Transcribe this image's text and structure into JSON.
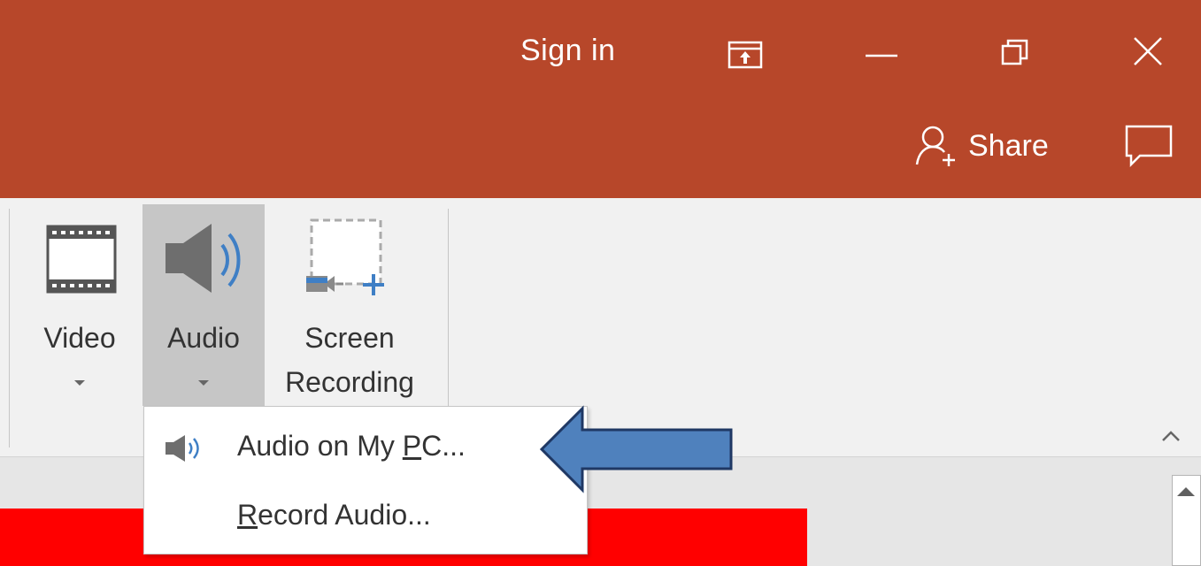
{
  "titlebar": {
    "sign_in": "Sign in",
    "share": "Share",
    "icons": [
      "ribbon-display-options-icon",
      "minimize-icon",
      "restore-icon",
      "close-icon",
      "person-add-icon",
      "comment-icon"
    ],
    "background": "#b7472a"
  },
  "ribbon": {
    "buttons": [
      {
        "label": "Video",
        "icon": "film-icon"
      },
      {
        "label": "Audio",
        "icon": "speaker-icon"
      },
      {
        "label_line1": "Screen",
        "label_line2": "Recording",
        "icon": "screen-recording-icon"
      }
    ]
  },
  "menu": {
    "items": [
      {
        "pre": "Audio on My ",
        "accel": "P",
        "post": "C...",
        "icon": "speaker-icon"
      },
      {
        "pre": "",
        "accel": "R",
        "post": "ecord Audio..."
      }
    ]
  },
  "colors": {
    "accent": "#b7472a",
    "arrow": "#4f81bd",
    "slide": "#ff0000"
  }
}
